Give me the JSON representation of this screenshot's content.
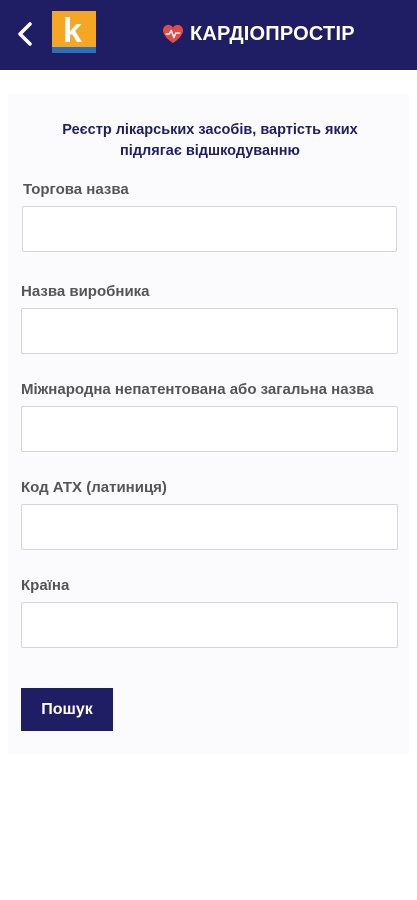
{
  "header": {
    "back_icon": "chevron-left-icon",
    "logo_letter": "k",
    "brand_icon": "heart-pulse-icon",
    "brand_name": "КАРДІОПРОСТІР",
    "colors": {
      "bar": "#1f1d64",
      "logo_orange": "#f5a623",
      "logo_blue": "#2a6fb8",
      "heart": "#e24b4b"
    }
  },
  "form": {
    "title": "Реєстр лікарських засобів, вартість яких підлягає відшкодуванню",
    "fields": [
      {
        "label": "Торгова назва",
        "value": ""
      },
      {
        "label": "Назва виробника",
        "value": ""
      },
      {
        "label": "Міжнародна непатентована або загальна назва",
        "value": ""
      },
      {
        "label": "Код АТХ (латиниця)",
        "value": ""
      },
      {
        "label": "Країна",
        "value": ""
      }
    ],
    "submit_label": "Пошук"
  }
}
